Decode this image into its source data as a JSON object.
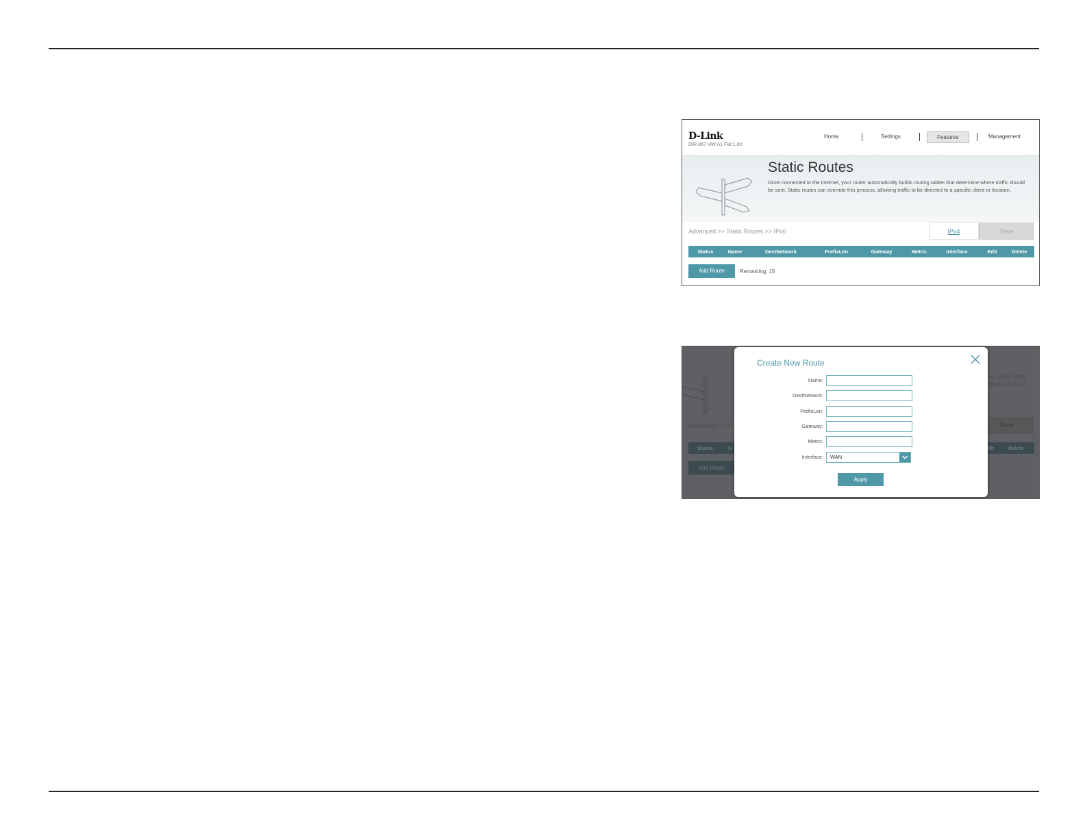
{
  "screen1": {
    "brand": "D-Link",
    "model": "DIR-867 HW:A1 FW:1.00",
    "nav": [
      "Home",
      "Settings",
      "Features",
      "Management"
    ],
    "active_nav": "Features",
    "title": "Static Routes",
    "description": "Once connected to the Internet, your router automatically builds routing tables that determine where traffic should be sent. Static routes can override this process, allowing traffic to be directed to a specific client or location.",
    "breadcrumb": "Advanced >> Static Routes >> IPv6",
    "ipv4_link": "IPv4",
    "save_label": "Save",
    "table_headers": [
      "Status",
      "Name",
      "DestNetwork",
      "PrefixLen",
      "Gateway",
      "Metric",
      "Interface",
      "Edit",
      "Delete"
    ],
    "add_route_label": "Add Route",
    "remaining": "Remaining: 15"
  },
  "screen2": {
    "background": {
      "desc_fragment_1": "ne where traffic",
      "desc_fragment_2": "pecific client or",
      "breadcrumb_fragment": "Advanced >> S",
      "save_label": "Save",
      "status_header": "Status",
      "name_header_fragment": "N",
      "edit_header_fragment": "dit",
      "delete_header": "Delete",
      "add_route_label": "Add Route"
    },
    "modal": {
      "title": "Create New Route",
      "fields": [
        {
          "label": "Name:",
          "value": ""
        },
        {
          "label": "DestNetwork:",
          "value": ""
        },
        {
          "label": "PrefixLen:",
          "value": ""
        },
        {
          "label": "Gateway:",
          "value": ""
        },
        {
          "label": "Metric:",
          "value": ""
        }
      ],
      "interface_label": "Interface:",
      "interface_value": "WAN",
      "apply_label": "Apply"
    }
  },
  "colors": {
    "accent": "#4f98a7",
    "rule": "#222222",
    "overlay": "#5f6063"
  }
}
